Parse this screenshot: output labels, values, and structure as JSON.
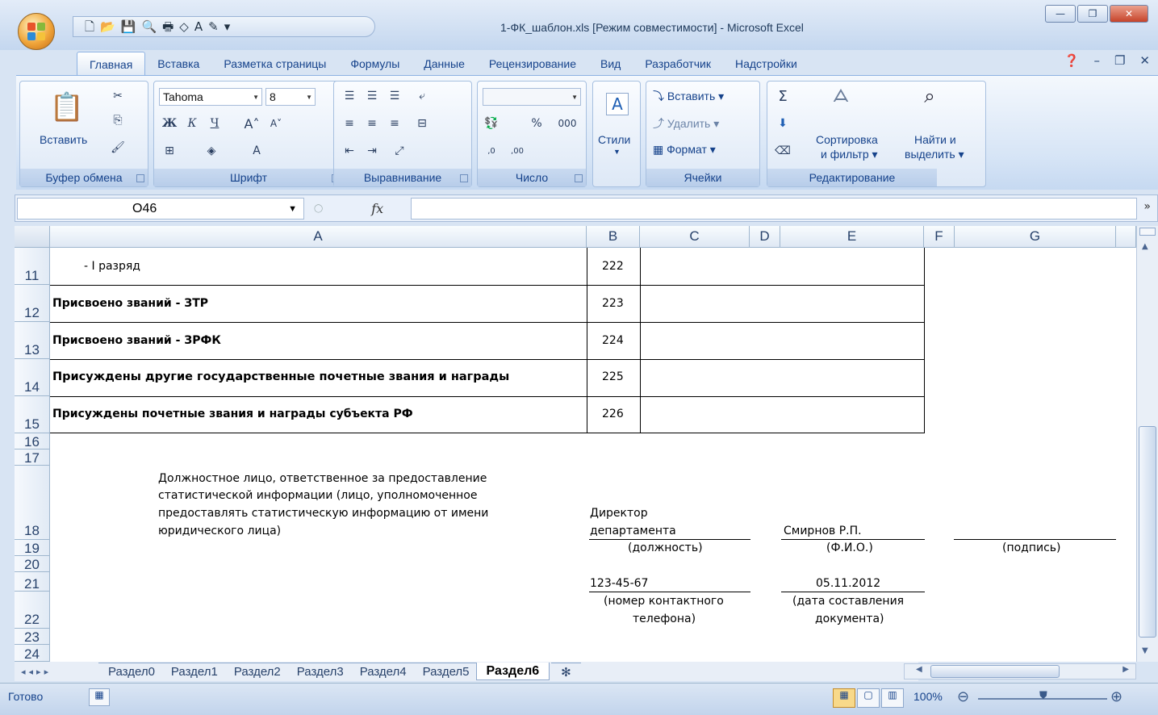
{
  "window": {
    "title": "1-ФК_шаблон.xls  [Режим совместимости] - Microsoft Excel"
  },
  "ribbon_tabs": [
    "Главная",
    "Вставка",
    "Разметка страницы",
    "Формулы",
    "Данные",
    "Рецензирование",
    "Вид",
    "Разработчик",
    "Надстройки"
  ],
  "clipboard": {
    "paste": "Вставить",
    "label": "Буфер обмена"
  },
  "font": {
    "name": "Tahoma",
    "size": "8",
    "bold": "Ж",
    "italic": "К",
    "underline": "Ч",
    "label": "Шрифт"
  },
  "alignment": {
    "label": "Выравнивание"
  },
  "number": {
    "percent": "%",
    "thousands": "000",
    "inc": ",0",
    "dec": ",00",
    "label": "Число"
  },
  "styles": {
    "label": "Стили"
  },
  "cells": {
    "insert": "Вставить",
    "delete": "Удалить",
    "format": "Формат",
    "label": "Ячейки"
  },
  "editing": {
    "sort": "Сортировка",
    "sort2": "и фильтр",
    "find": "Найти и",
    "find2": "выделить",
    "label": "Редактирование"
  },
  "formula_bar": {
    "name_box": "O46",
    "fx": "fx",
    "value": ""
  },
  "columns": [
    "A",
    "B",
    "C",
    "D",
    "E",
    "F",
    "G"
  ],
  "rows": {
    "r11": {
      "num": "11",
      "a": "- I разряд",
      "b": "222"
    },
    "r12": {
      "num": "12",
      "a": "Присвоено званий - ЗТР",
      "b": "223"
    },
    "r13": {
      "num": "13",
      "a": "Присвоено званий - ЗРФК",
      "b": "224"
    },
    "r14": {
      "num": "14",
      "a": "Присуждены другие государственные почетные звания и награды",
      "b": "225"
    },
    "r15": {
      "num": "15",
      "a": "Присуждены почетные звания и награды субъекта РФ",
      "b": "226"
    },
    "r16": "16",
    "r17": "17",
    "r18": "18",
    "r19": "19",
    "r20": "20",
    "r21": "21",
    "r22": "22",
    "r23": "23",
    "r24": "24"
  },
  "footer": {
    "official_1": "Должностное лицо, ответственное за предоставление",
    "official_2": "статистической информации (лицо, уполномоченное",
    "official_3": "предоставлять статистическую информацию от имени",
    "official_4": "юридического лица)",
    "position_1": "Директор",
    "position_2": "департамента",
    "name": "Смирнов Р.П.",
    "position_label": "(должность)",
    "name_label": "(Ф.И.О.)",
    "signature_label": "(подпись)",
    "phone": "123-45-67",
    "date": "05.11.2012",
    "phone_label_1": "(номер контактного",
    "phone_label_2": "телефона)",
    "date_label_1": "(дата составления",
    "date_label_2": "документа)"
  },
  "sheet_tabs": [
    "Раздел0",
    "Раздел1",
    "Раздел2",
    "Раздел3",
    "Раздел4",
    "Раздел5",
    "Раздел6"
  ],
  "status": {
    "ready": "Готово",
    "zoom": "100%"
  }
}
